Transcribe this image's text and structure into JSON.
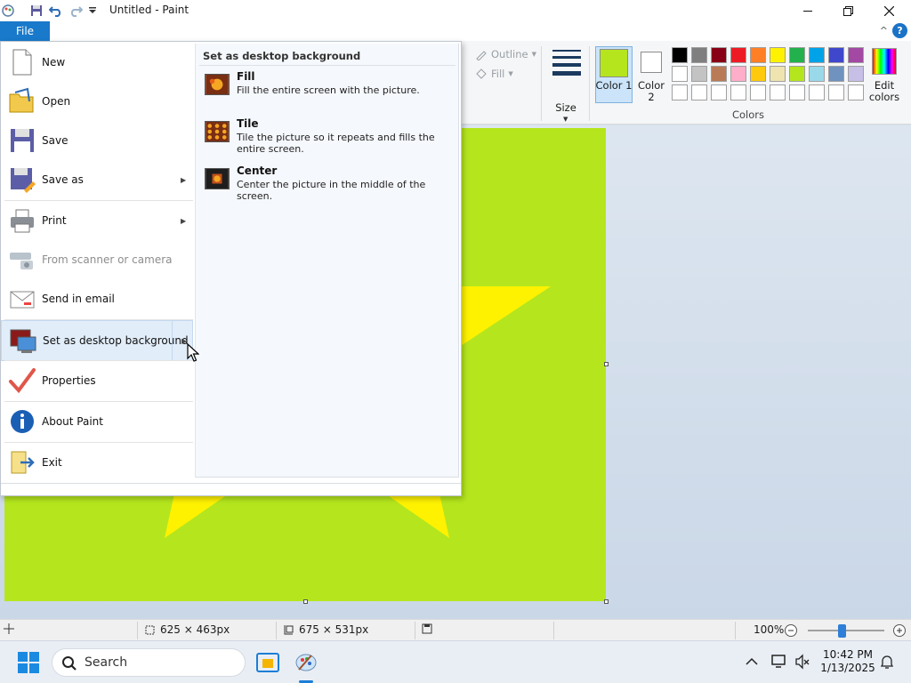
{
  "window": {
    "title": "Untitled - Paint",
    "tab_file": "File",
    "help": "?",
    "collapse": "^"
  },
  "ribbon": {
    "outline_label": "Outline",
    "fill_label": "Fill",
    "size_label": "Size",
    "color1_label": "Color 1",
    "color2_label": "Color 2",
    "edit_colors_label": "Edit colors",
    "colors_group_label": "Colors",
    "color1_value": "#b5e61d",
    "color2_value": "#ffffff",
    "palette": [
      "#000000",
      "#7f7f7f",
      "#880015",
      "#ed1c24",
      "#ff7f27",
      "#fff200",
      "#22b14c",
      "#00a2e8",
      "#3f48cc",
      "#a349a4",
      "#ffffff",
      "#c3c3c3",
      "#b97a57",
      "#ffaec9",
      "#ffc90e",
      "#efe4b0",
      "#b5e61d",
      "#99d9ea",
      "#7092be",
      "#c8bfe7",
      "#ffffff",
      "#ffffff",
      "#ffffff",
      "#ffffff",
      "#ffffff",
      "#ffffff",
      "#ffffff",
      "#ffffff",
      "#ffffff",
      "#ffffff"
    ]
  },
  "file_menu": {
    "items": [
      {
        "label": "New",
        "icon": "new-document-icon"
      },
      {
        "label": "Open",
        "icon": "open-folder-icon"
      },
      {
        "label": "Save",
        "icon": "save-disk-icon"
      },
      {
        "label": "Save as",
        "icon": "save-as-icon"
      },
      {
        "label": "Print",
        "icon": "printer-icon"
      },
      {
        "label": "From scanner or camera",
        "icon": "scanner-icon"
      },
      {
        "label": "Send in email",
        "icon": "email-icon"
      },
      {
        "label": "Set as desktop background",
        "icon": "desktop-background-icon"
      },
      {
        "label": "Properties",
        "icon": "checkmark-icon"
      },
      {
        "label": "About Paint",
        "icon": "info-icon"
      },
      {
        "label": "Exit",
        "icon": "exit-icon"
      }
    ],
    "submenu": {
      "header": "Set as desktop background",
      "items": [
        {
          "title": "Fill",
          "desc": "Fill the entire screen with the picture."
        },
        {
          "title": "Tile",
          "desc": "Tile the picture so it repeats and fills the entire screen."
        },
        {
          "title": "Center",
          "desc": "Center the picture in the middle of the screen."
        }
      ]
    }
  },
  "canvas": {
    "background": "#b5e61d",
    "star_color": "#fff200"
  },
  "statusbar": {
    "selection_size": "625 × 463px",
    "image_size": "675 × 531px",
    "zoom": "100%",
    "zoom_level_percent": 100
  },
  "taskbar": {
    "search_placeholder": "Search",
    "time": "10:42 PM",
    "date": "1/13/2025"
  }
}
